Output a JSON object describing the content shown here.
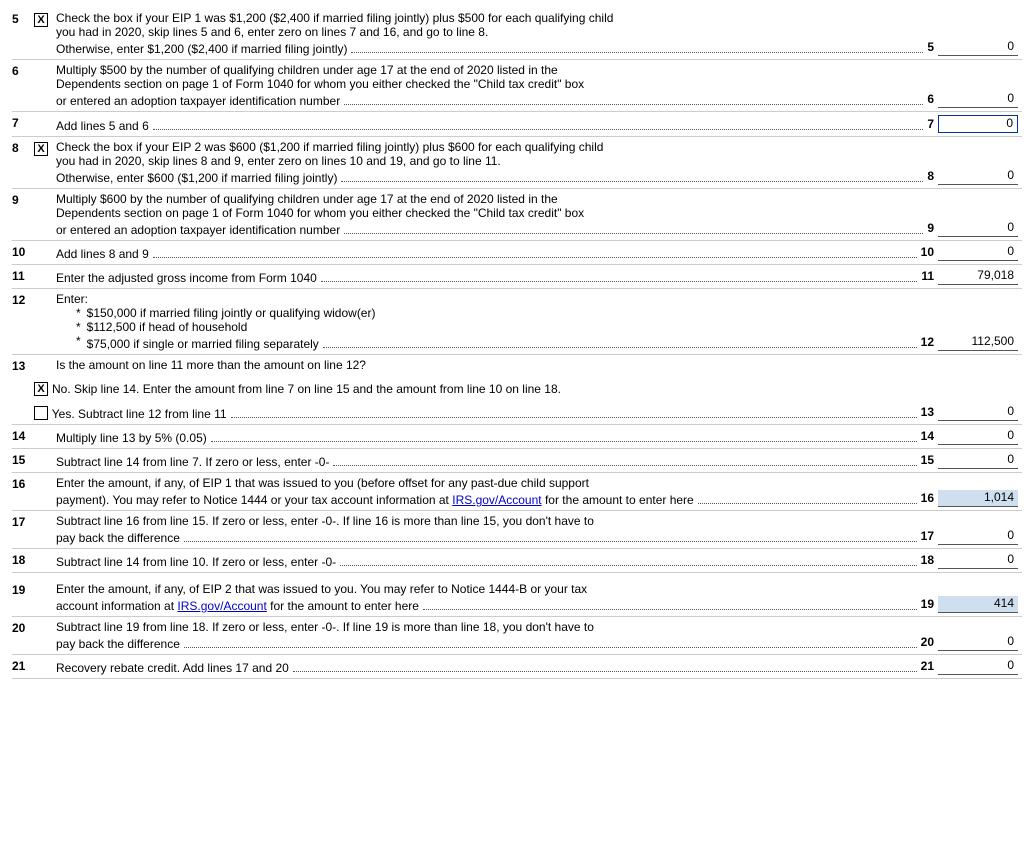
{
  "lines": [
    {
      "num": "5",
      "checkbox": "X",
      "text_lines": [
        "Check the box if your EIP 1 was $1,200 ($2,400 if married filing jointly) plus $500 for each qualifying child",
        "you had in 2020, skip lines 5 and 6, enter zero on lines 7 and 16, and go to line 8.",
        "Otherwise, enter $1,200 ($2,400 if married filing jointly)"
      ],
      "field_label": "5",
      "field_value": "0",
      "highlighted": false,
      "outlined": false
    },
    {
      "num": "6",
      "checkbox": null,
      "text_lines": [
        "Multiply $500 by the number of qualifying children under age 17 at the end of 2020 listed in the",
        "Dependents section on page 1 of Form 1040 for whom you either checked the \"Child tax credit\" box",
        "or entered an adoption taxpayer identification number"
      ],
      "field_label": "6",
      "field_value": "0",
      "highlighted": false,
      "outlined": false
    },
    {
      "num": "7",
      "checkbox": null,
      "text_lines": [
        "Add lines 5 and 6"
      ],
      "field_label": "7",
      "field_value": "0",
      "highlighted": false,
      "outlined": true
    },
    {
      "num": "8",
      "checkbox": "X",
      "text_lines": [
        "Check the box if your EIP 2 was $600 ($1,200 if married filing jointly) plus $600 for each qualifying child",
        "you had in 2020, skip lines 8 and 9, enter zero on lines 10 and 19, and go to line 11.",
        "Otherwise, enter $600 ($1,200 if married filing jointly)"
      ],
      "field_label": "8",
      "field_value": "0",
      "highlighted": false,
      "outlined": false
    },
    {
      "num": "9",
      "checkbox": null,
      "text_lines": [
        "Multiply $600 by the number of qualifying children under age 17 at the end of 2020 listed in the",
        "Dependents section on page 1 of Form 1040 for whom you either checked the \"Child tax credit\" box",
        "or entered an adoption taxpayer identification number"
      ],
      "field_label": "9",
      "field_value": "0",
      "highlighted": false,
      "outlined": false
    },
    {
      "num": "10",
      "checkbox": null,
      "text_lines": [
        "Add lines 8 and 9"
      ],
      "field_label": "10",
      "field_value": "0",
      "highlighted": false,
      "outlined": false
    },
    {
      "num": "11",
      "checkbox": null,
      "text_lines": [
        "Enter the adjusted gross income from Form 1040"
      ],
      "field_label": "11",
      "field_value": "79,018",
      "highlighted": false,
      "outlined": false
    }
  ],
  "line12": {
    "num": "12",
    "label": "Enter:",
    "bullets": [
      "$150,000 if married filing jointly or qualifying widow(er)",
      "$112,500 if head of household",
      "$75,000 if single or married filing separately"
    ],
    "field_label": "12",
    "field_value": "112,500"
  },
  "line13": {
    "num": "13",
    "label": "Is the amount on line 11 more than the amount on line 12?",
    "no_text": "No. Skip line 14. Enter the amount from line 7 on line 15 and the amount from line 10 on line 18.",
    "yes_text": "Yes. Subtract line 12 from line 11",
    "field_label": "13",
    "field_value": "0"
  },
  "line14": {
    "num": "14",
    "text": "Multiply line 13 by 5% (0.05)",
    "field_label": "14",
    "field_value": "0"
  },
  "line15": {
    "num": "15",
    "text": "Subtract line 14 from line 7. If zero or less, enter  -0-",
    "field_label": "15",
    "field_value": "0"
  },
  "line16": {
    "num": "16",
    "text_parts": [
      "Enter the amount, if any, of EIP 1 that was issued to you (before offset for any past-due child support",
      "payment). You may refer to Notice 1444 or your tax account information at",
      "for the amount to enter here"
    ],
    "link": "IRS.gov/Account",
    "field_label": "16",
    "field_value": "1,014",
    "highlighted": true
  },
  "line17": {
    "num": "17",
    "text_lines": [
      "Subtract line 16 from line 15. If zero or less, enter -0-. If line 16 is more than line 15, you don't have to",
      "pay back the difference"
    ],
    "field_label": "17",
    "field_value": "0"
  },
  "line18": {
    "num": "18",
    "text": "Subtract line 14 from line 10. If zero or less, enter  -0-",
    "field_label": "18",
    "field_value": "0"
  },
  "line19": {
    "num": "19",
    "text_parts": [
      "Enter the amount, if any, of EIP 2 that was issued to you. You may refer to Notice 1444-B or your tax",
      "account information at",
      "for the amount to enter here"
    ],
    "link": "IRS.gov/Account",
    "field_label": "19",
    "field_value": "414",
    "highlighted": true
  },
  "line20": {
    "num": "20",
    "text_lines": [
      "Subtract line 19 from line 18. If zero or less, enter -0-. If line 19 is more than line 18, you don't have to",
      "pay back the difference"
    ],
    "field_label": "20",
    "field_value": "0"
  },
  "line21": {
    "num": "21",
    "text": "Recovery rebate credit. Add lines 17 and 20",
    "field_label": "21",
    "field_value": "0"
  }
}
